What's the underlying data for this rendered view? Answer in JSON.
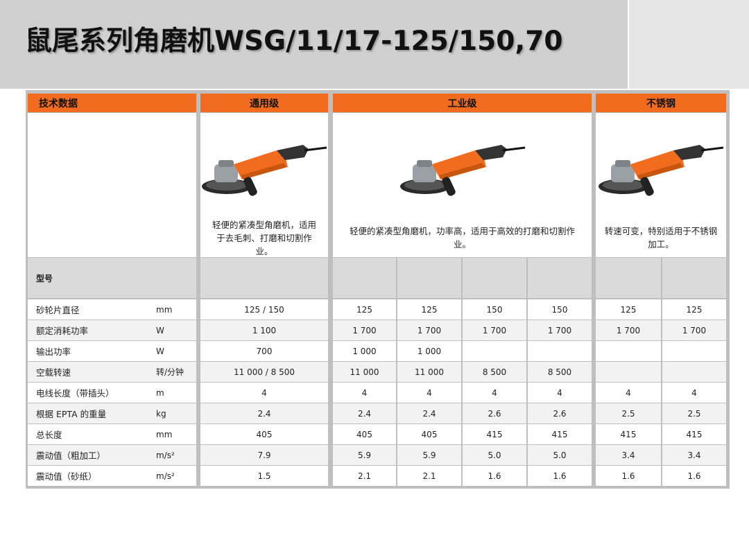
{
  "title": "鼠尾系列角磨机WSG/11/17-125/150,70",
  "headers": {
    "tech": "技术数据",
    "general": "通用级",
    "industrial": "工业级",
    "stainless": "不锈钢"
  },
  "descriptions": {
    "general": "轻便的紧凑型角磨机，适用于去毛刺、打磨和切割作业。",
    "industrial": "轻便的紧凑型角磨机，功率高，适用于高效的打磨和切割作业。",
    "stainless": "转速可变，特别适用于不锈钢加工。"
  },
  "model_label": "型号",
  "rows": [
    {
      "label": "砂轮片直径",
      "unit": "mm",
      "values": [
        "125 / 150",
        "125",
        "125",
        "150",
        "150",
        "125",
        "125"
      ]
    },
    {
      "label": "额定消耗功率",
      "unit": "W",
      "values": [
        "1 100",
        "1 700",
        "1 700",
        "1 700",
        "1 700",
        "1 700",
        "1 700"
      ]
    },
    {
      "label": "输出功率",
      "unit": "W",
      "values": [
        "700",
        "1 000",
        "1 000",
        "",
        "",
        "",
        ""
      ]
    },
    {
      "label": "空载转速",
      "unit": "转/分钟",
      "values": [
        "11 000 / 8 500",
        "11 000",
        "11 000",
        "8 500",
        "8 500",
        "",
        ""
      ]
    },
    {
      "label": "电线长度（带插头）",
      "unit": "m",
      "values": [
        "4",
        "4",
        "4",
        "4",
        "4",
        "4",
        "4"
      ]
    },
    {
      "label": "根据 EPTA 的重量",
      "unit": "kg",
      "values": [
        "2.4",
        "2.4",
        "2.4",
        "2.6",
        "2.6",
        "2.5",
        "2.5"
      ]
    },
    {
      "label": "总长度",
      "unit": "mm",
      "values": [
        "405",
        "405",
        "405",
        "415",
        "415",
        "415",
        "415"
      ]
    },
    {
      "label": "震动值（粗加工）",
      "unit": "m/s²",
      "values": [
        "7.9",
        "5.9",
        "5.9",
        "5.0",
        "5.0",
        "3.4",
        "3.4"
      ]
    },
    {
      "label": "震动值（砂纸）",
      "unit": "m/s²",
      "values": [
        "1.5",
        "2.1",
        "2.1",
        "1.6",
        "1.6",
        "1.6",
        "1.6"
      ]
    }
  ],
  "colors": {
    "accent": "#f26c1f",
    "title_band": "#d0d0d0",
    "model_row": "#dadada"
  }
}
